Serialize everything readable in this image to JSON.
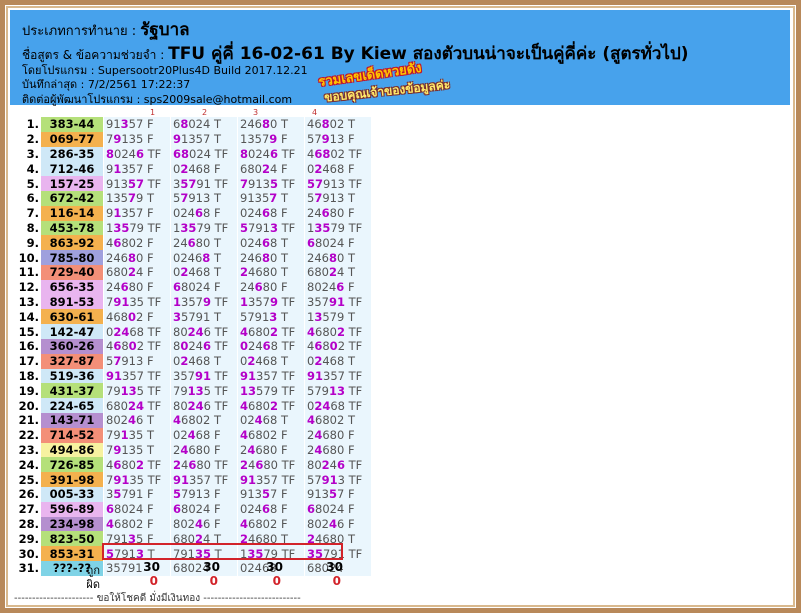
{
  "header": {
    "line1_label": "ประเภทการทำนาย :",
    "line1_value": "รัฐบาล",
    "line2_label": "ชื่อสูตร & ข้อความช่วยจำ :",
    "line2_value": "TFU คู่คี่ 16-02-61 By Kiew สองตัวบนน่าจะเป็นคู่คี่ค่ะ (สูตรทั่วไป)",
    "line3": "โดยโปรแกรม : Supersootr20Plus4D Build 2017.12.21",
    "line4": "บันทึกล่าสุด : 7/2/2561 17:22:37",
    "line5": "ติดต่อผู้พัฒนาโปรแกรม : sps2009sale@hotmail.com"
  },
  "sticker": {
    "line1": "รวมเลขเด็ดหวยดัง",
    "line2": "ขอบคุณเจ้าของข้อมูลค่ะ"
  },
  "col_numbers": [
    "1",
    "2",
    "3",
    "4"
  ],
  "rows": [
    {
      "n": "1.",
      "pair": "383-44",
      "bg": "#b5e07a",
      "c": [
        "91357 F",
        "68024 T",
        "24680 T",
        "46802 T"
      ]
    },
    {
      "n": "2.",
      "pair": "069-77",
      "bg": "#f4b14e",
      "c": [
        "79135 F",
        "91357 T",
        "13579 F",
        "57913 F"
      ]
    },
    {
      "n": "3.",
      "pair": "286-35",
      "bg": "#cfe8f7",
      "c": [
        "80246 TF",
        "68024 TF",
        "80246 TF",
        "46802 TF"
      ]
    },
    {
      "n": "4.",
      "pair": "712-46",
      "bg": "#cfe8f7",
      "c": [
        "91357 F",
        "02468 F",
        "68024 F",
        "02468 F"
      ]
    },
    {
      "n": "5.",
      "pair": "157-25",
      "bg": "#e9b5ef",
      "c": [
        "91357 TF",
        "35791 TF",
        "79135 TF",
        "57913 TF"
      ]
    },
    {
      "n": "6.",
      "pair": "672-42",
      "bg": "#b5e07a",
      "c": [
        "13579 T",
        "57913 T",
        "91357 T",
        "57913 T"
      ]
    },
    {
      "n": "7.",
      "pair": "116-14",
      "bg": "#f4b14e",
      "c": [
        "91357 F",
        "02468 F",
        "02468 F",
        "24680 F"
      ]
    },
    {
      "n": "8.",
      "pair": "453-78",
      "bg": "#b5e07a",
      "c": [
        "13579 TF",
        "13579 TF",
        "57913 TF",
        "13579 TF"
      ]
    },
    {
      "n": "9.",
      "pair": "863-92",
      "bg": "#f4b14e",
      "c": [
        "46802 F",
        "24680 T",
        "02468 T",
        "68024 F"
      ]
    },
    {
      "n": "10.",
      "pair": "785-80",
      "bg": "#9fa0dd",
      "c": [
        "24680 F",
        "02468 T",
        "24680 T",
        "24680 T"
      ]
    },
    {
      "n": "11.",
      "pair": "729-40",
      "bg": "#f38f78",
      "c": [
        "68024 F",
        "02468 T",
        "24680 T",
        "68024 T"
      ]
    },
    {
      "n": "12.",
      "pair": "656-35",
      "bg": "#e9b5ef",
      "c": [
        "24680 F",
        "68024 F",
        "24680 F",
        "80246 F"
      ]
    },
    {
      "n": "13.",
      "pair": "891-53",
      "bg": "#e9b5ef",
      "c": [
        "79135 TF",
        "13579 TF",
        "13579 TF",
        "35791 TF"
      ]
    },
    {
      "n": "14.",
      "pair": "630-61",
      "bg": "#f4b14e",
      "c": [
        "46802 F",
        "35791 T",
        "57913 T",
        "13579 T"
      ]
    },
    {
      "n": "15.",
      "pair": "142-47",
      "bg": "#cfe8f7",
      "c": [
        "02468 TF",
        "80246 TF",
        "46802 TF",
        "46802 TF"
      ]
    },
    {
      "n": "16.",
      "pair": "360-26",
      "bg": "#b58fcf",
      "c": [
        "46802 TF",
        "80246 TF",
        "02468 TF",
        "46802 TF"
      ]
    },
    {
      "n": "17.",
      "pair": "327-87",
      "bg": "#f38f78",
      "c": [
        "57913 F",
        "02468 T",
        "02468 T",
        "02468 T"
      ]
    },
    {
      "n": "18.",
      "pair": "519-36",
      "bg": "#cfe8f7",
      "c": [
        "91357 TF",
        "35791 TF",
        "91357 TF",
        "91357 TF"
      ]
    },
    {
      "n": "19.",
      "pair": "431-37",
      "bg": "#b5e07a",
      "c": [
        "79135 TF",
        "79135 TF",
        "13579 TF",
        "57913 TF"
      ]
    },
    {
      "n": "20.",
      "pair": "224-65",
      "bg": "#cfe8f7",
      "c": [
        "68024 TF",
        "80246 TF",
        "46802 TF",
        "02468 TF"
      ]
    },
    {
      "n": "21.",
      "pair": "143-71",
      "bg": "#b58fcf",
      "c": [
        "80246 T",
        "46802 T",
        "02468 T",
        "46802 T"
      ]
    },
    {
      "n": "22.",
      "pair": "714-52",
      "bg": "#f38f78",
      "c": [
        "79135 T",
        "02468 F",
        "46802 F",
        "24680 F"
      ]
    },
    {
      "n": "23.",
      "pair": "494-86",
      "bg": "#f7f2a0",
      "c": [
        "79135 T",
        "24680 F",
        "24680 F",
        "24680 F"
      ]
    },
    {
      "n": "24.",
      "pair": "726-85",
      "bg": "#b5e07a",
      "c": [
        "46802 TF",
        "24680 TF",
        "24680 TF",
        "80246 TF"
      ]
    },
    {
      "n": "25.",
      "pair": "391-98",
      "bg": "#f4b14e",
      "c": [
        "79135 TF",
        "91357 TF",
        "91357 TF",
        "57913 TF"
      ]
    },
    {
      "n": "26.",
      "pair": "005-33",
      "bg": "#cfe8f7",
      "c": [
        "35791 F",
        "57913 F",
        "91357 F",
        "91357 F"
      ]
    },
    {
      "n": "27.",
      "pair": "596-89",
      "bg": "#e9b5ef",
      "c": [
        "68024 F",
        "68024 F",
        "02468 F",
        "68024 F"
      ]
    },
    {
      "n": "28.",
      "pair": "234-98",
      "bg": "#b58fcf",
      "c": [
        "46802 F",
        "80246 F",
        "46802 F",
        "80246 F"
      ]
    },
    {
      "n": "29.",
      "pair": "823-50",
      "bg": "#b5e07a",
      "c": [
        "79135 F",
        "68024 T",
        "24680 T",
        "24680 T"
      ]
    },
    {
      "n": "30.",
      "pair": "853-31",
      "bg": "#f4b14e",
      "c": [
        "57913 T",
        "79135 T",
        "13579 TF",
        "35791 TF"
      ]
    },
    {
      "n": "31.",
      "pair": "???-??",
      "bg": "#7fd3e6",
      "c": [
        "35791",
        "68024",
        "02468",
        "68024"
      ]
    }
  ],
  "summary": {
    "correct_label": "ถูก",
    "wrong_label": "ผิด",
    "correct": [
      "30",
      "30",
      "30",
      "30"
    ],
    "wrong": [
      "0",
      "0",
      "0",
      "0"
    ]
  },
  "footer_text": "---------------------- ขอให้โชคดี มั่งมีเงินทอง ---------------------------"
}
